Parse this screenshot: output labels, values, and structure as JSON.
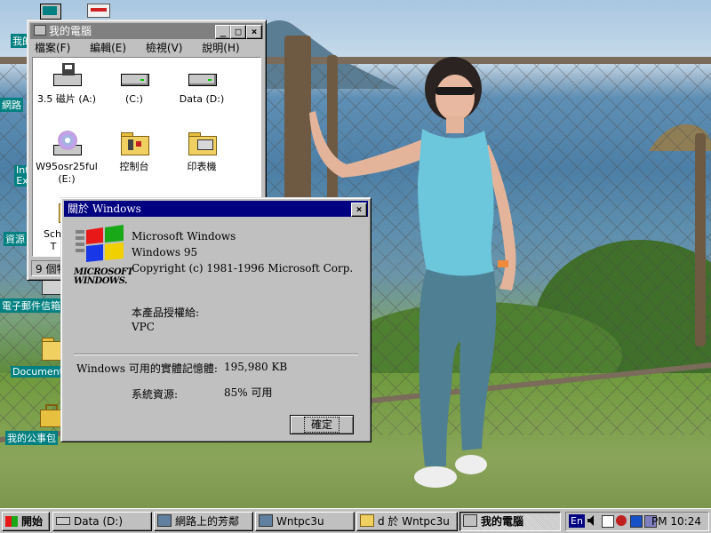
{
  "desktop": {
    "icons": [
      {
        "label": "我的",
        "icon": "my-computer-icon"
      },
      {
        "label": "網路",
        "icon": "network-icon"
      },
      {
        "label": "Int Ex",
        "icon": "internet-explorer-icon"
      },
      {
        "label": "資源",
        "icon": "recycle-bin-icon"
      },
      {
        "label": "電子郵件信箱",
        "icon": "inbox-icon"
      },
      {
        "label": "Document",
        "icon": "folder-icon"
      },
      {
        "label": "我的公事包",
        "icon": "briefcase-icon"
      }
    ]
  },
  "mycomputer": {
    "title": "我的電腦",
    "menu": [
      "檔案(F)",
      "編輯(E)",
      "檢視(V)",
      "說明(H)"
    ],
    "items": [
      {
        "label": "3.5 磁片 (A:)",
        "icon": "floppy-drive-icon"
      },
      {
        "label": "(C:)",
        "icon": "hard-drive-icon"
      },
      {
        "label": "Data (D:)",
        "icon": "hard-drive-icon"
      },
      {
        "label": "W95osr25ful (E:)",
        "icon": "cdrom-drive-icon"
      },
      {
        "label": "控制台",
        "icon": "control-panel-icon"
      },
      {
        "label": "印表機",
        "icon": "printers-icon"
      },
      {
        "label": "Sche T",
        "icon": "scheduled-tasks-icon"
      }
    ],
    "status": "9 個物"
  },
  "about": {
    "title": "關於 Windows",
    "logo_text": "MICROSOFT WINDOWS.",
    "product": "Microsoft Windows",
    "version": "Windows 95",
    "copyright": "Copyright (c) 1981-1996 Microsoft Corp.",
    "licensed_label": "本產品授權給:",
    "licensed_to": "VPC",
    "memory_label": "Windows 可用的實體記憶體:",
    "memory_value": "195,980 KB",
    "resources_label": "系統資源:",
    "resources_value": "85% 可用",
    "ok_label": "確定"
  },
  "taskbar": {
    "start_label": "開始",
    "buttons": [
      {
        "label": "Data (D:)",
        "pressed": false
      },
      {
        "label": "網路上的芳鄰",
        "pressed": false
      },
      {
        "label": "Wntpc3u",
        "pressed": false
      },
      {
        "label": "d 於 Wntpc3u",
        "pressed": false
      },
      {
        "label": "我的電腦",
        "pressed": true
      }
    ],
    "tray": {
      "lang": "En",
      "clock": "PM 10:24"
    }
  },
  "colors": {
    "titlebar_active": "#000080",
    "titlebar_inactive": "#808080",
    "desktop_label_bg": "#008080",
    "face": "#c0c0c0"
  }
}
